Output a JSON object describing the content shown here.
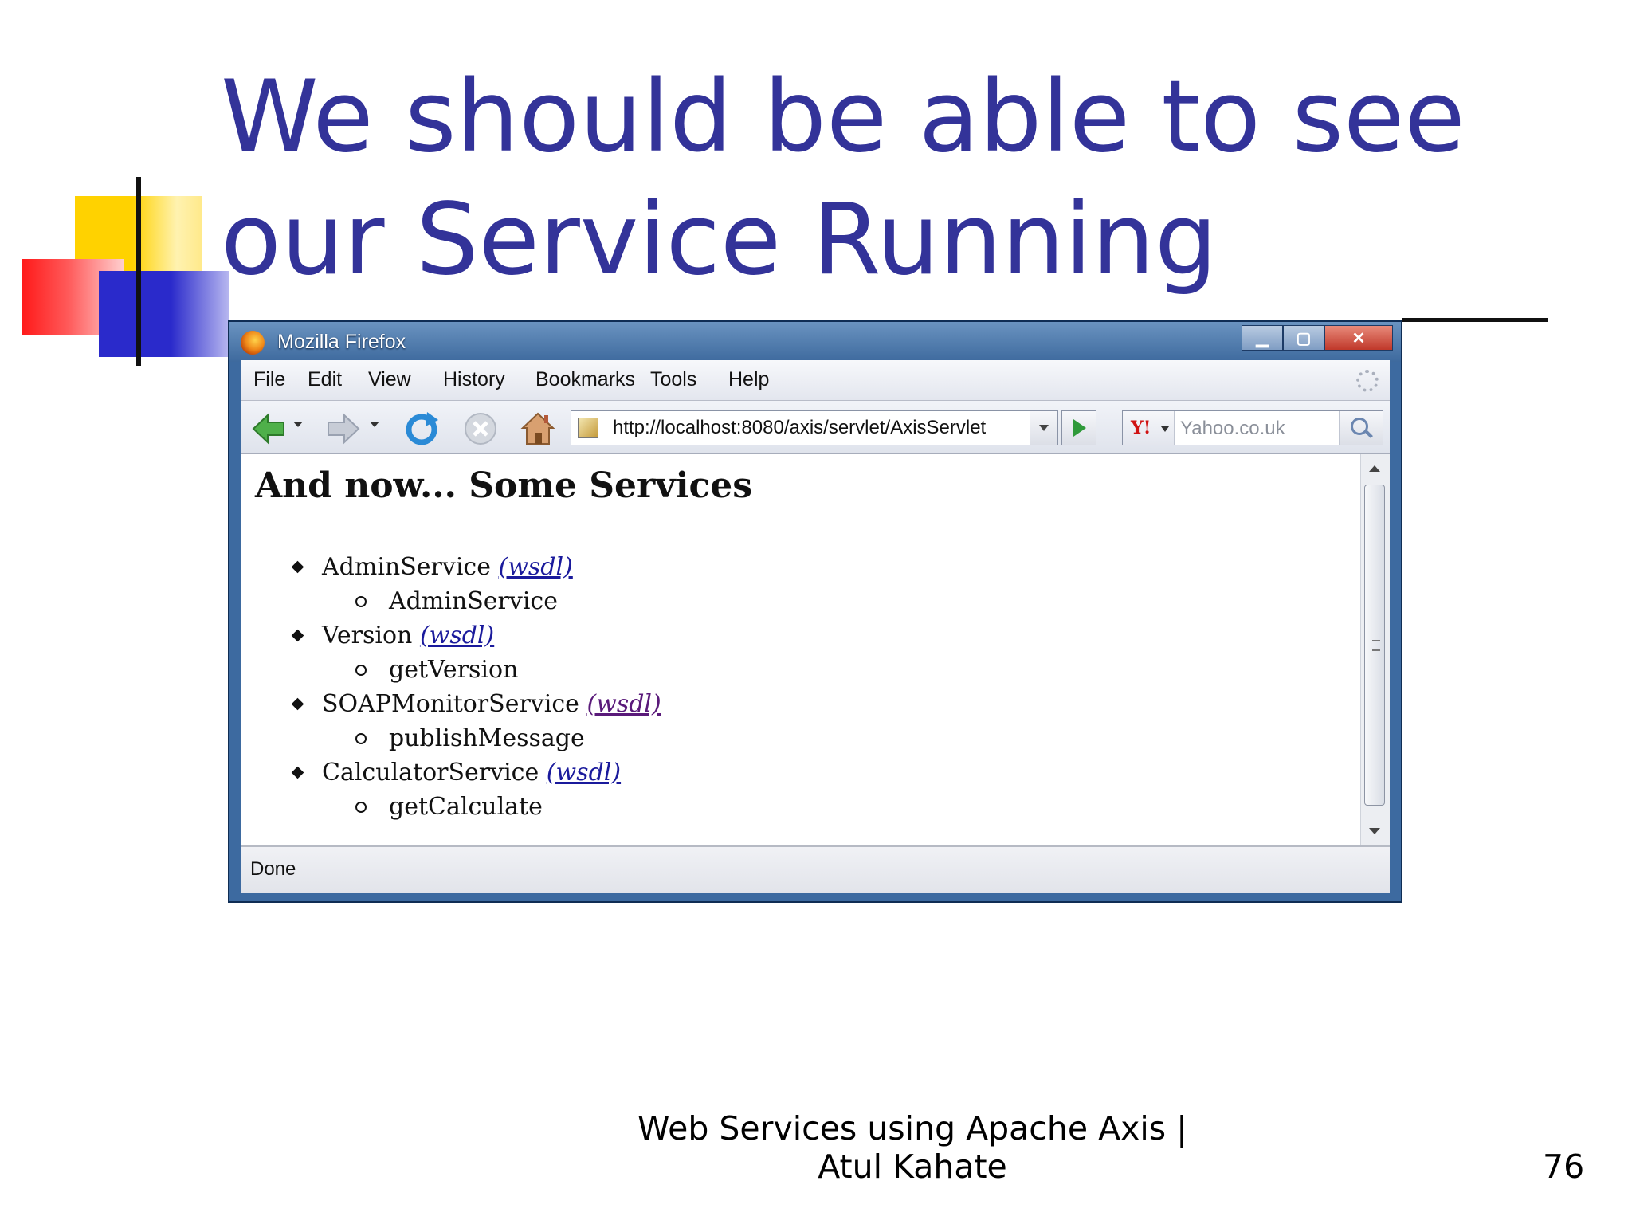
{
  "slide": {
    "title": "We should be able to see our Service Running",
    "footer_line1": "Web Services using Apache Axis |",
    "footer_line2": "Atul Kahate",
    "page_number": "76"
  },
  "browser": {
    "window_title": "Mozilla Firefox",
    "menu": [
      "File",
      "Edit",
      "View",
      "History",
      "Bookmarks",
      "Tools",
      "Help"
    ],
    "url": "http://localhost:8080/axis/servlet/AxisServlet",
    "search_placeholder": "Yahoo.co.uk",
    "search_engine_label": "Y!",
    "status": "Done",
    "icons": {
      "back": "back-arrow-icon",
      "forward": "forward-arrow-icon",
      "reload": "reload-icon",
      "stop": "stop-icon",
      "home": "home-icon",
      "go": "go-icon",
      "search": "magnifier-icon"
    }
  },
  "page": {
    "heading": "And now... Some Services",
    "wsdl_label": "(wsdl)",
    "services": [
      {
        "name": "AdminService",
        "operation": "AdminService"
      },
      {
        "name": "Version",
        "operation": "getVersion"
      },
      {
        "name": "SOAPMonitorService",
        "operation": "publishMessage"
      },
      {
        "name": "CalculatorService",
        "operation": "getCalculate"
      }
    ]
  },
  "colors": {
    "title": "#333399",
    "link": "#1a1a9c",
    "visited_link": "#5a1a7a"
  }
}
